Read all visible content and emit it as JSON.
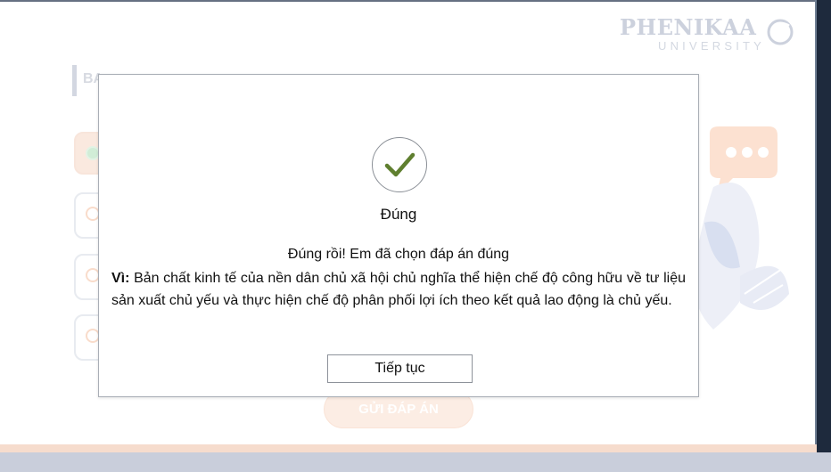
{
  "background": {
    "logo": {
      "word": "PHENIKAA",
      "sub": "UNIVERSITY"
    },
    "question": {
      "text": "BA"
    },
    "submit_label": "GỬI ĐÁP ÁN"
  },
  "modal": {
    "icon": "check-icon",
    "title": "Đúng",
    "message": "Đúng rồi! Em đã chọn đáp án đúng",
    "explanation_prefix": "Vì:",
    "explanation": "Bản chất kinh tế của nền dân chủ xã hội chủ nghĩa thể hiện chế độ công hữu về tư liệu sản xuất chủ yếu và thực hiện chế độ phân phối lợi ích theo kết quả lao động là chủ yếu.",
    "continue_label": "Tiếp tục"
  },
  "colors": {
    "accent": "#f9e1d3",
    "check": "#5f7f2f",
    "frame": "#1e2a3d"
  }
}
